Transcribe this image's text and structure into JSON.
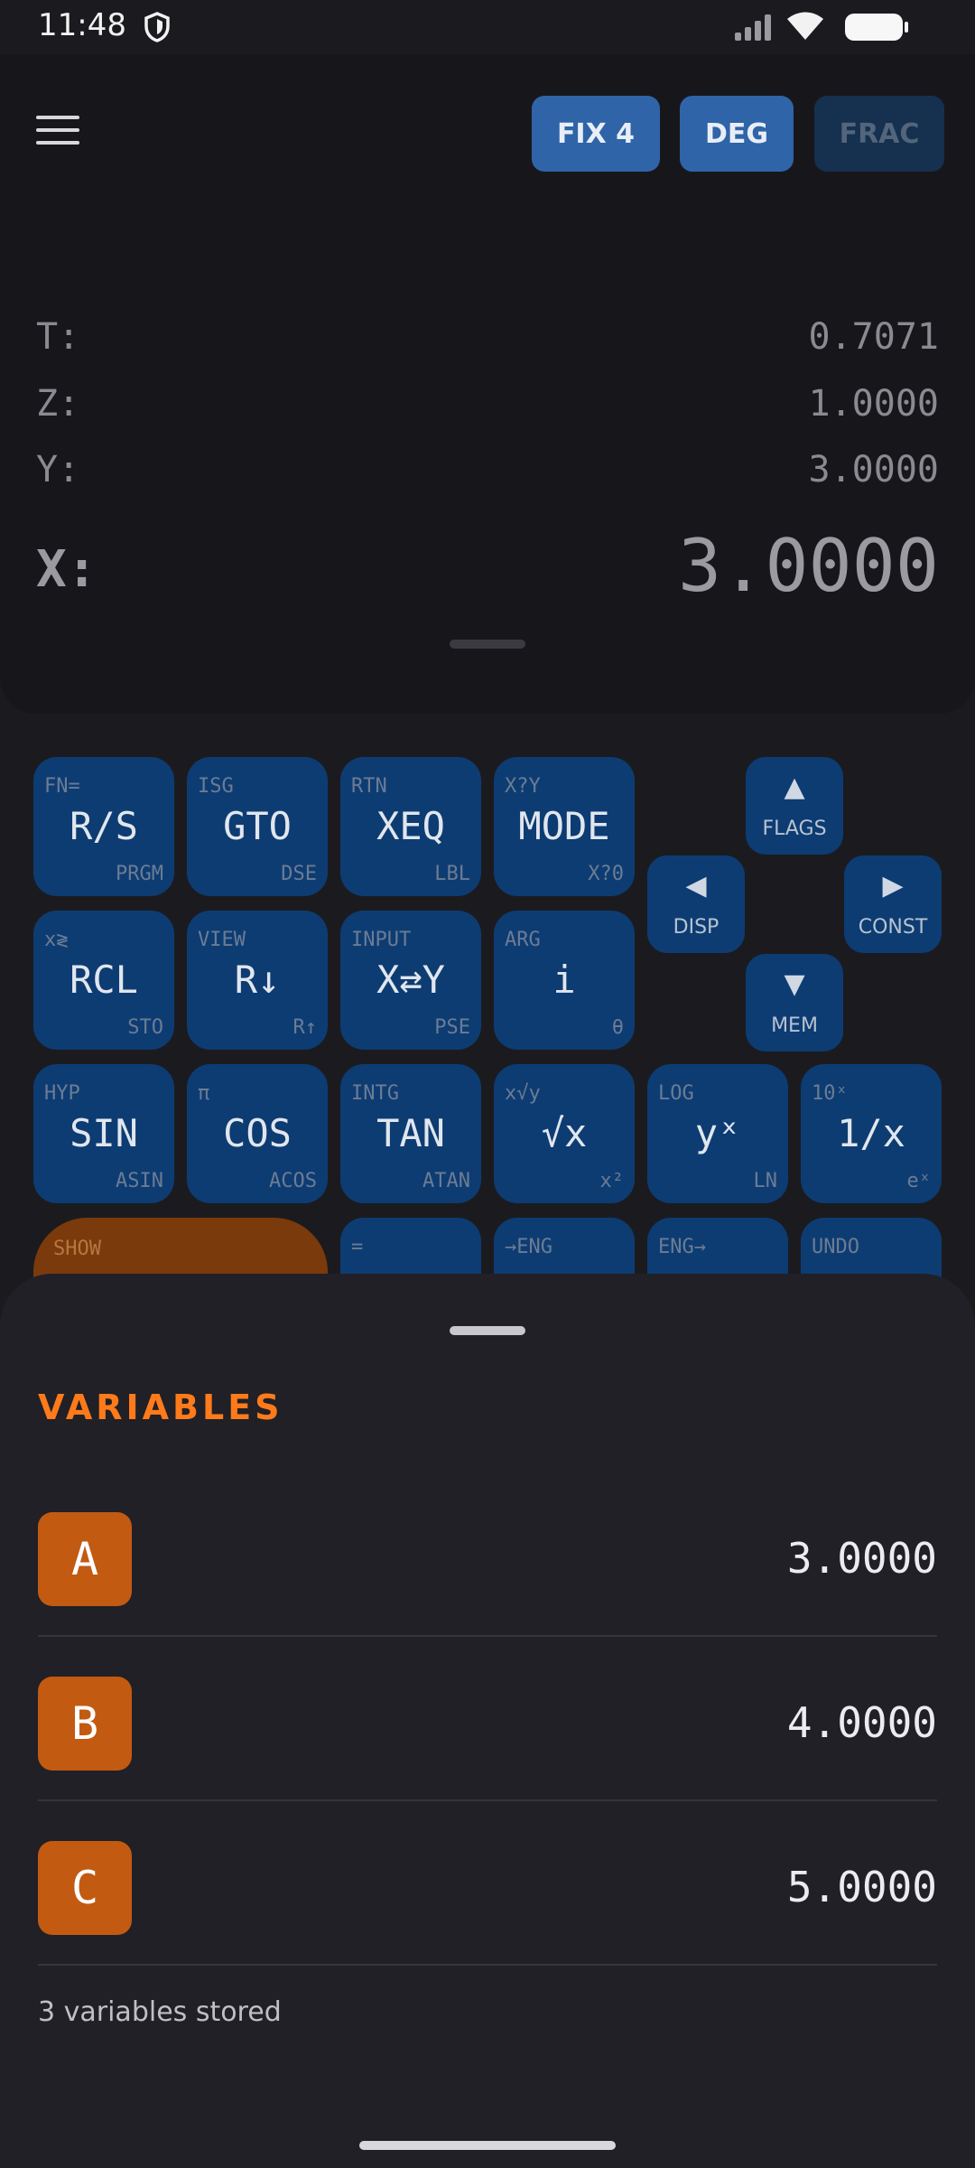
{
  "status": {
    "time": "11:48"
  },
  "toolbar": {
    "fix": "FIX 4",
    "deg": "DEG",
    "frac": "FRAC"
  },
  "stack": [
    {
      "label": "T:",
      "value": "0.7071"
    },
    {
      "label": "Z:",
      "value": "1.0000"
    },
    {
      "label": "Y:",
      "value": "3.0000"
    }
  ],
  "x": {
    "label": "X:",
    "value": "3.0000"
  },
  "keys": {
    "row1": [
      {
        "sup": "FN=",
        "main": "R/S",
        "sub": "PRGM"
      },
      {
        "sup": "ISG",
        "main": "GTO",
        "sub": "DSE"
      },
      {
        "sup": "RTN",
        "main": "XEQ",
        "sub": "LBL"
      },
      {
        "sup": "X?Y",
        "main": "MODE",
        "sub": "X?0"
      }
    ],
    "row2": [
      {
        "sup": "x≷",
        "main": "RCL",
        "sub": "STO"
      },
      {
        "sup": "VIEW",
        "main": "R↓",
        "sub": "R↑"
      },
      {
        "sup": "INPUT",
        "main": "X⇄Y",
        "sub": "PSE"
      },
      {
        "sup": "ARG",
        "main": "i",
        "sub": "θ"
      }
    ],
    "row3": [
      {
        "sup": "HYP",
        "main": "SIN",
        "sub": "ASIN"
      },
      {
        "sup": "π",
        "main": "COS",
        "sub": "ACOS"
      },
      {
        "sup": "INTG",
        "main": "TAN",
        "sub": "ATAN"
      },
      {
        "sup": "x√y",
        "main": "√x",
        "sub": "x²"
      },
      {
        "sup": "LOG",
        "main": "yˣ",
        "sub": "LN"
      },
      {
        "sup": "10ˣ",
        "main": "1/x",
        "sub": "eˣ"
      }
    ],
    "row4": [
      {
        "sup": "="
      },
      {
        "sup": "→ENG"
      },
      {
        "sup": "ENG→"
      },
      {
        "sup": "UNDO"
      }
    ],
    "enter_sup": "SHOW",
    "arrows": {
      "up": "FLAGS",
      "left": "DISP",
      "right": "CONST",
      "down": "MEM"
    }
  },
  "sheet": {
    "title": "VARIABLES",
    "variables": [
      {
        "name": "A",
        "value": "3.0000"
      },
      {
        "name": "B",
        "value": "4.0000"
      },
      {
        "name": "C",
        "value": "5.0000"
      }
    ],
    "footer": "3 variables stored"
  }
}
